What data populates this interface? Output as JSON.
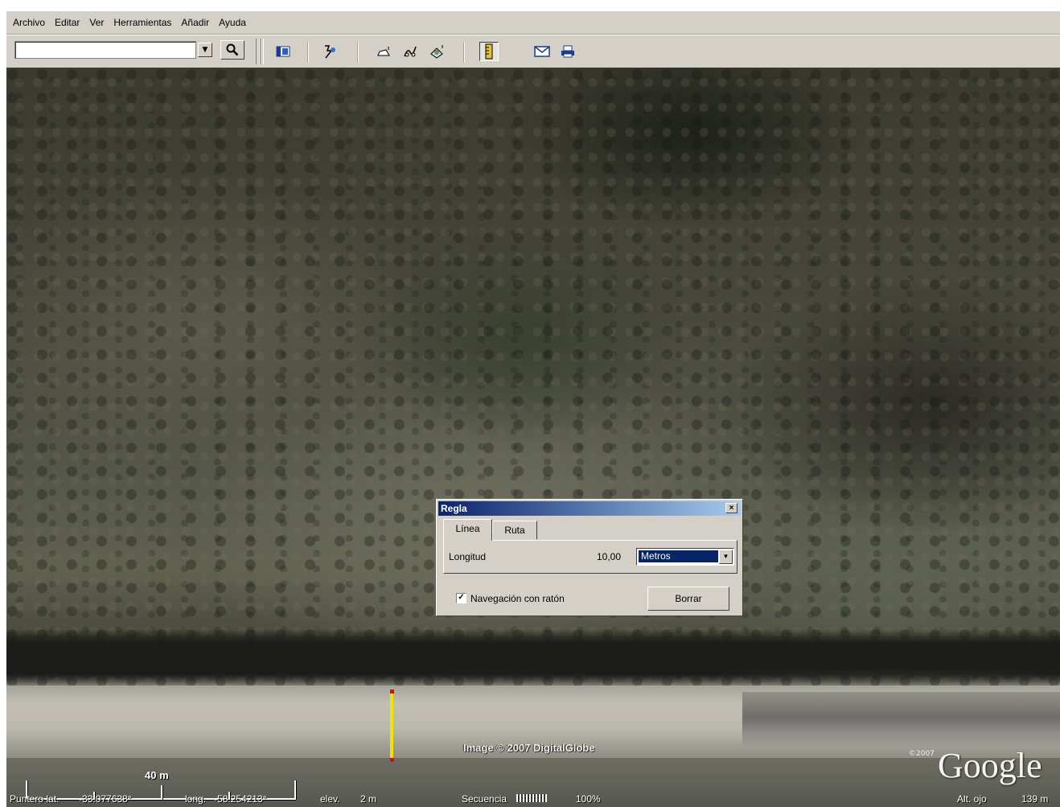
{
  "menu": {
    "items": [
      "Archivo",
      "Editar",
      "Ver",
      "Herramientas",
      "Añadir",
      "Ayuda"
    ]
  },
  "search": {
    "value": "",
    "placeholder": ""
  },
  "toolbar": {
    "icons": [
      "sidebar-icon",
      "placemark-icon",
      "polygon-icon",
      "path-icon",
      "overlay-icon",
      "ruler-icon",
      "email-icon",
      "print-icon"
    ]
  },
  "ruler_dialog": {
    "title": "Regla",
    "close": "×",
    "tabs": [
      "Línea",
      "Ruta"
    ],
    "length_label": "Longitud",
    "length_value": "10,00",
    "unit": "Metros",
    "mouse_nav_label": "Navegación con ratón",
    "mouse_nav_checked": true,
    "clear_button": "Borrar"
  },
  "map": {
    "attribution": "Image © 2007 DigitalGlobe",
    "brand": "Google",
    "brand_copyright": "©2007",
    "scale_label": "40 m"
  },
  "status": {
    "pointer_lat_label": "Puntero lat.",
    "pointer_lat": "-33.077638°",
    "lon_label": "long.",
    "lon": "-58.254213°",
    "elev_label": "elev.",
    "elev": "2 m",
    "stream_label": "Secuencia",
    "stream_percent": "100%",
    "altitude_label": "Alt. ojo",
    "altitude": "139 m"
  }
}
